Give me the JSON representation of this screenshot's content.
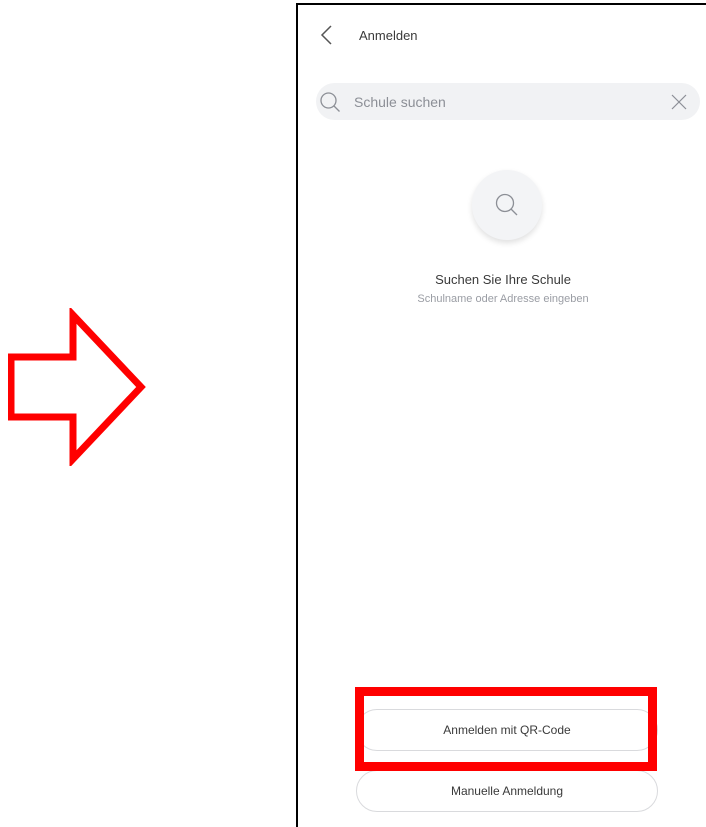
{
  "header": {
    "title": "Anmelden"
  },
  "search": {
    "placeholder": "Schule suchen",
    "value": ""
  },
  "empty_state": {
    "title": "Suchen Sie Ihre Schule",
    "subtitle": "Schulname oder Adresse eingeben"
  },
  "buttons": {
    "qr_login": "Anmelden mit QR-Code",
    "manual_login": "Manuelle Anmeldung"
  },
  "icons": {
    "back": "chevron-left-icon",
    "search": "search-icon",
    "clear": "close-icon",
    "empty_state": "search-icon"
  },
  "colors": {
    "annotation": "#ff0000",
    "search_background": "#f1f2f4",
    "text_primary": "#3a3a3a",
    "text_secondary": "#9a9da4"
  }
}
